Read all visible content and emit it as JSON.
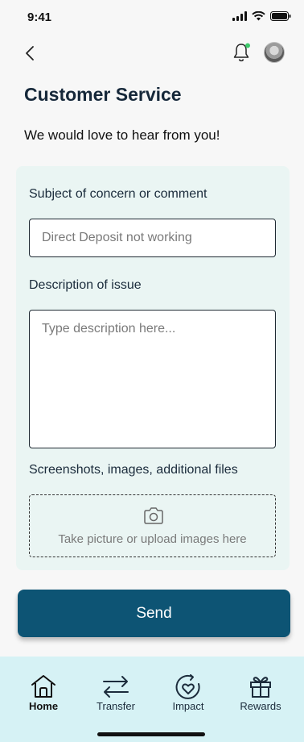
{
  "status_bar": {
    "time": "9:41"
  },
  "page": {
    "title": "Customer Service",
    "subtitle": "We would love to hear from you!"
  },
  "form": {
    "subject_label": "Subject of concern or comment",
    "subject_placeholder": "Direct Deposit not working",
    "description_label": "Description of issue",
    "description_placeholder": "Type description here...",
    "files_label": "Screenshots, images, additional files",
    "upload_text": "Take picture or upload images here",
    "send_label": "Send"
  },
  "tabs": [
    {
      "label": "Home",
      "icon": "home-icon",
      "active": true
    },
    {
      "label": "Transfer",
      "icon": "transfer-icon",
      "active": false
    },
    {
      "label": "Impact",
      "icon": "impact-icon",
      "active": false
    },
    {
      "label": "Rewards",
      "icon": "gift-icon",
      "active": false
    }
  ],
  "colors": {
    "primary": "#0d5474",
    "card_bg": "#eaf5f3",
    "tab_bar_bg": "#d6f2f5",
    "notification_dot": "#3cc96a"
  }
}
